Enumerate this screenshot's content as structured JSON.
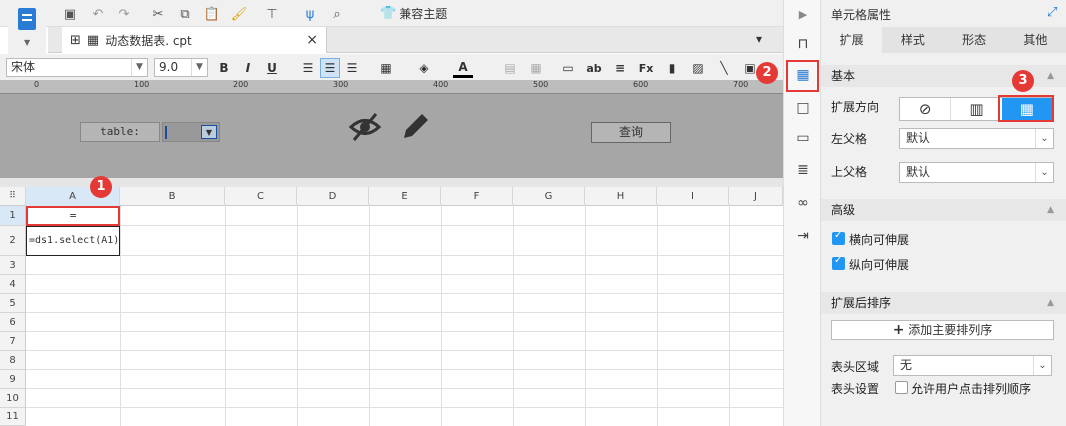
{
  "toolbar": {
    "theme_label": "兼容主题"
  },
  "document_tab": {
    "title": "动态数据表. cpt",
    "close": "×"
  },
  "format": {
    "font_name": "宋体",
    "font_size": "9.0",
    "bold": "B",
    "italic": "I",
    "underline": "U"
  },
  "ruler": {
    "ticks": [
      "0",
      "100",
      "200",
      "300",
      "400",
      "500",
      "600",
      "700"
    ]
  },
  "param_panel": {
    "label": "table:",
    "query_button": "查询"
  },
  "grid": {
    "columns": [
      "A",
      "B",
      "C",
      "D",
      "E",
      "F",
      "G",
      "H",
      "I",
      "J"
    ],
    "rows": [
      "1",
      "2",
      "3",
      "4",
      "5",
      "6",
      "7",
      "8",
      "9",
      "10",
      "11"
    ],
    "cell_a1": "=",
    "cell_a2": "=ds1.select(A1)"
  },
  "badges": {
    "one": "1",
    "two": "2",
    "three": "3"
  },
  "panel": {
    "title": "单元格属性",
    "tabs": [
      "扩展",
      "样式",
      "形态",
      "其他"
    ],
    "basic_section": "基本",
    "expand_direction_label": "扩展方向",
    "left_parent_label": "左父格",
    "left_parent_value": "默认",
    "top_parent_label": "上父格",
    "top_parent_value": "默认",
    "advanced_section": "高级",
    "horizontal_expand": "横向可伸展",
    "vertical_expand": "纵向可伸展",
    "sort_section": "扩展后排序",
    "add_sort_button": "添加主要排列序",
    "header_area_label": "表头区域",
    "header_area_value": "无",
    "header_settings_label": "表头设置",
    "allow_user_sort": "允许用户点击排列顺序"
  },
  "colors": {
    "accent": "#2196f3",
    "badge": "#e53935",
    "param_bg": "#a6a6a6"
  }
}
